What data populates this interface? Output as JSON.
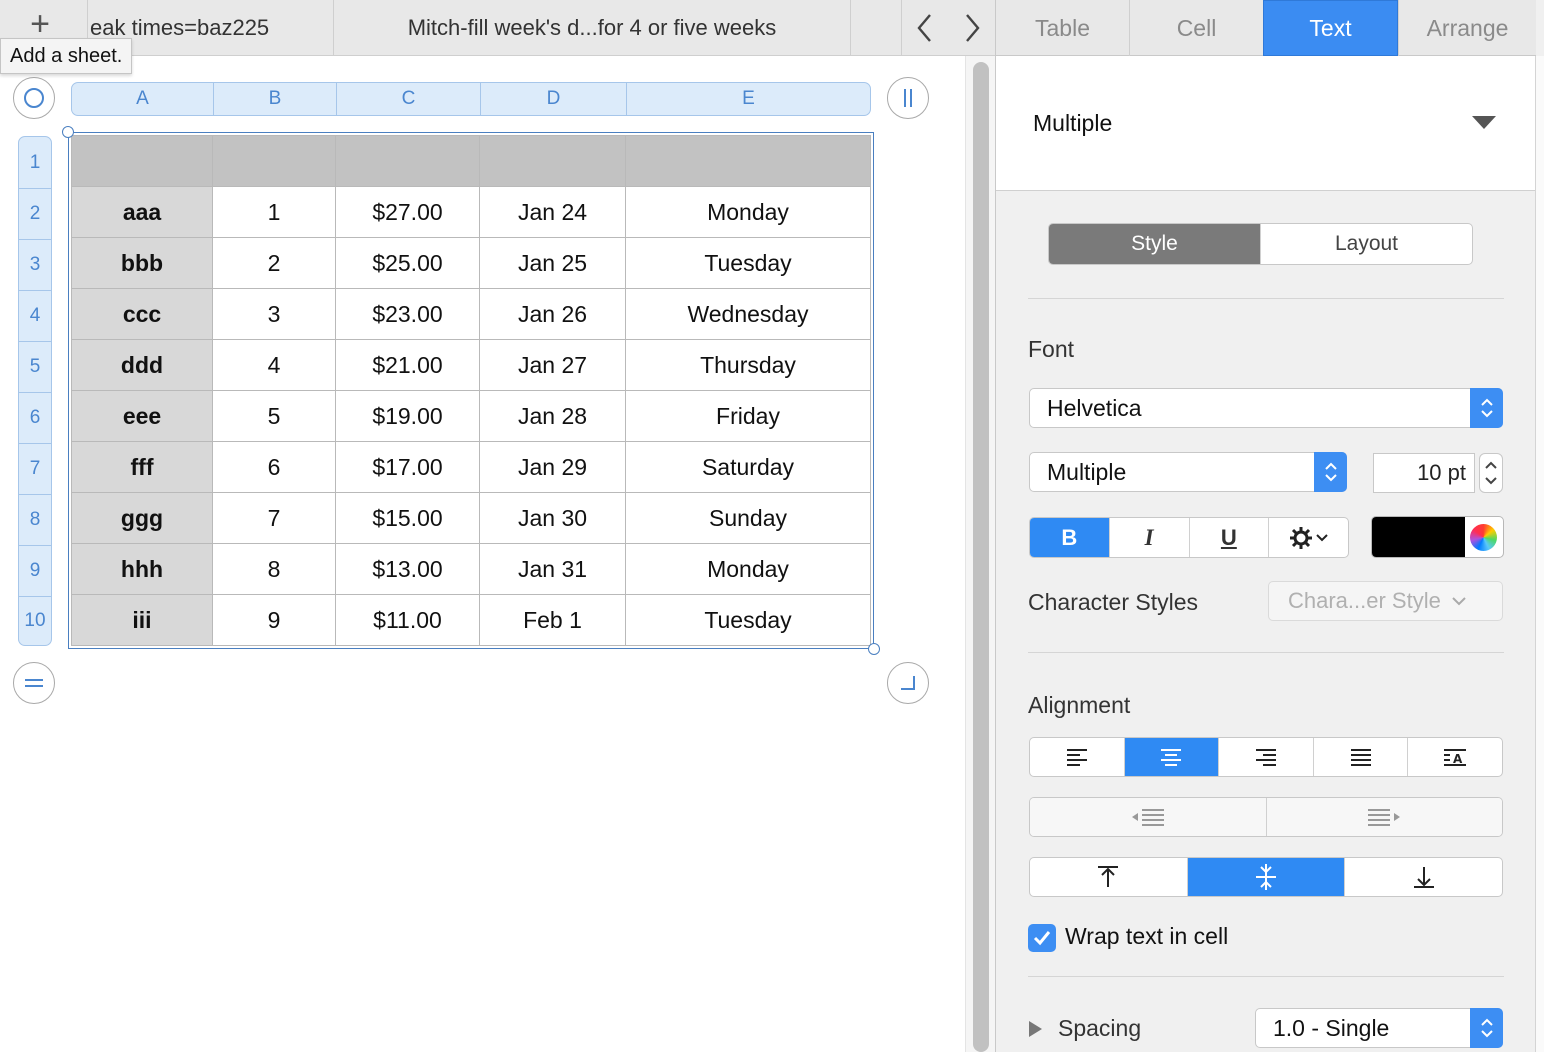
{
  "sheet_tabs": {
    "add_glyph": "+",
    "tooltip": "Add a sheet.",
    "tabs": [
      {
        "label": "eak times=baz225"
      },
      {
        "label": "Mitch-fill week's d...for 4 or five weeks"
      }
    ]
  },
  "table": {
    "column_headers": [
      "A",
      "B",
      "C",
      "D",
      "E"
    ],
    "row_headers": [
      "1",
      "2",
      "3",
      "4",
      "5",
      "6",
      "7",
      "8",
      "9",
      "10"
    ],
    "rows": [
      [
        "aaa",
        "1",
        "$27.00",
        "Jan 24",
        "Monday"
      ],
      [
        "bbb",
        "2",
        "$25.00",
        "Jan 25",
        "Tuesday"
      ],
      [
        "ccc",
        "3",
        "$23.00",
        "Jan 26",
        "Wednesday"
      ],
      [
        "ddd",
        "4",
        "$21.00",
        "Jan 27",
        "Thursday"
      ],
      [
        "eee",
        "5",
        "$19.00",
        "Jan 28",
        "Friday"
      ],
      [
        "fff",
        "6",
        "$17.00",
        "Jan 29",
        "Saturday"
      ],
      [
        "ggg",
        "7",
        "$15.00",
        "Jan 30",
        "Sunday"
      ],
      [
        "hhh",
        "8",
        "$13.00",
        "Jan 31",
        "Monday"
      ],
      [
        "iii",
        "9",
        "$11.00",
        "Feb 1",
        "Tuesday"
      ]
    ]
  },
  "inspector": {
    "tabs": [
      {
        "label": "Table",
        "active": false
      },
      {
        "label": "Cell",
        "active": false
      },
      {
        "label": "Text",
        "active": true
      },
      {
        "label": "Arrange",
        "active": false
      }
    ],
    "paragraph_style": "Multiple",
    "sub_tabs": {
      "style": "Style",
      "layout": "Layout"
    },
    "font": {
      "section_label": "Font",
      "family": "Helvetica",
      "typeface": "Multiple",
      "size": "10 pt",
      "bold_label": "B",
      "italic_label": "I",
      "underline_label": "U",
      "text_color": "#000000"
    },
    "character_styles": {
      "label": "Character Styles",
      "value": "Chara...er Style"
    },
    "alignment": {
      "label": "Alignment",
      "horizontal_selected": "center",
      "vertical_selected": "middle"
    },
    "wrap_text": {
      "label": "Wrap text in cell",
      "checked": true
    },
    "spacing": {
      "label": "Spacing",
      "value": "1.0 - Single"
    }
  },
  "colors": {
    "accent": "#3b8cf2",
    "header_fill": "#c2c2c2",
    "label_column_fill": "#d8d8d8"
  }
}
